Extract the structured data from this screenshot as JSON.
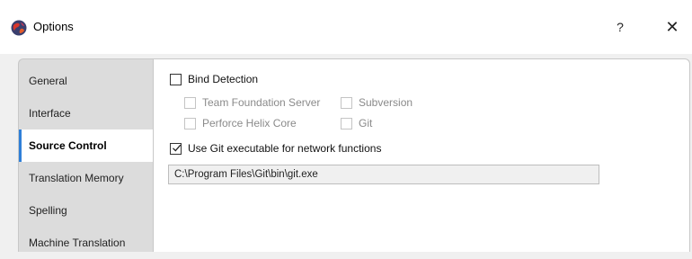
{
  "window": {
    "title": "Options",
    "help_label": "?",
    "close_label": "✕",
    "icon": "app-globe-icon"
  },
  "sidebar": {
    "items": [
      {
        "label": "General",
        "active": false
      },
      {
        "label": "Interface",
        "active": false
      },
      {
        "label": "Source Control",
        "active": true
      },
      {
        "label": "Translation Memory",
        "active": false
      },
      {
        "label": "Spelling",
        "active": false
      },
      {
        "label": "Machine Translation",
        "active": false
      }
    ]
  },
  "source_control": {
    "bind_detection": {
      "label": "Bind Detection",
      "checked": false,
      "enabled": true
    },
    "options": [
      {
        "label": "Team Foundation Server",
        "checked": false,
        "enabled": false
      },
      {
        "label": "Subversion",
        "checked": false,
        "enabled": false
      },
      {
        "label": "Perforce Helix Core",
        "checked": false,
        "enabled": false
      },
      {
        "label": "Git",
        "checked": false,
        "enabled": false
      }
    ],
    "use_git": {
      "label": "Use Git executable for network functions",
      "checked": true,
      "enabled": true
    },
    "git_path": "C:\\Program Files\\Git\\bin\\git.exe"
  },
  "colors": {
    "accent": "#2f7fd8",
    "sidebar_bg": "#dcdcdc",
    "panel_bg": "#ffffff",
    "disabled_text": "#8a8a8a"
  }
}
